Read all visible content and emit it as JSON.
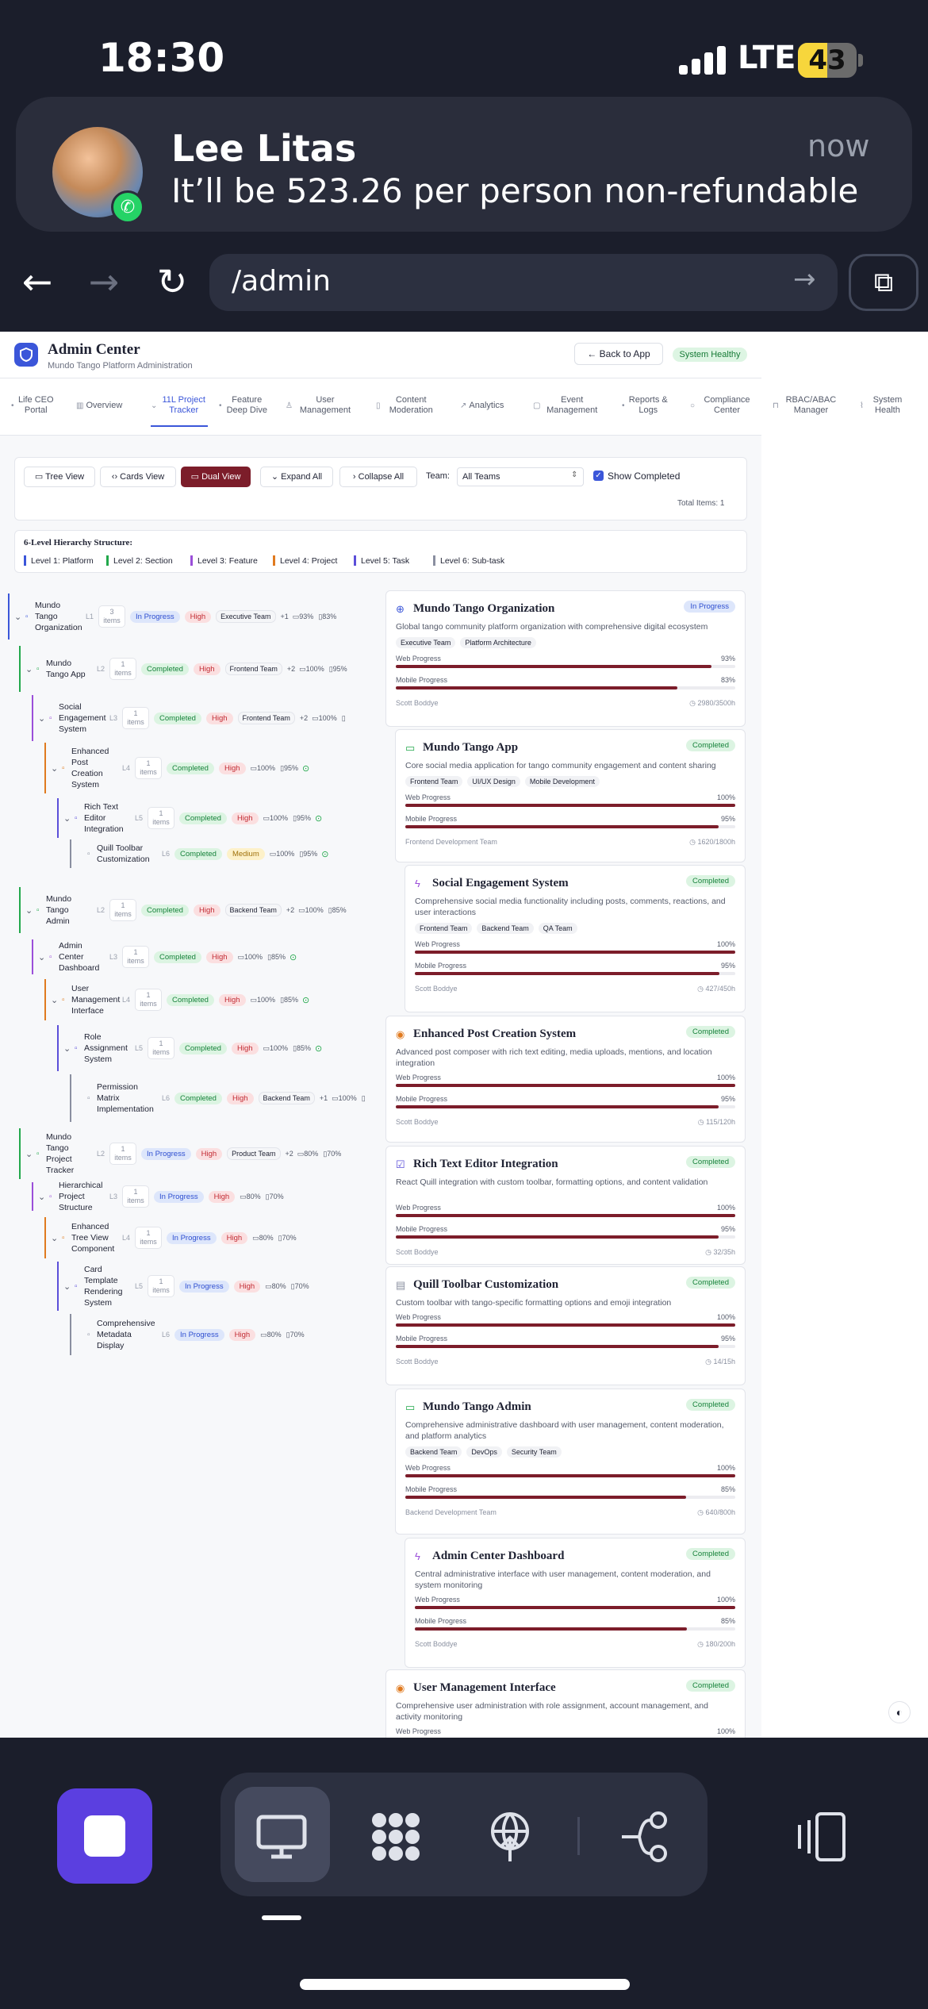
{
  "status": {
    "time": "18:30",
    "network": "LTE",
    "battery": "43"
  },
  "notification": {
    "sender": "Lee Litas",
    "time": "now",
    "message": "It’ll be 523.26 per person non-refundable"
  },
  "browser": {
    "url": "/admin"
  },
  "header": {
    "title": "Admin Center",
    "subtitle": "Mundo Tango Platform Administration",
    "back_label": "Back to App",
    "status_badge": "System Healthy"
  },
  "tabs": [
    {
      "label": "Life CEO Portal"
    },
    {
      "label": "Overview"
    },
    {
      "label": "11L Project Tracker",
      "active": true
    },
    {
      "label": "Feature Deep Dive"
    },
    {
      "label": "User Management"
    },
    {
      "label": "Content Moderation"
    },
    {
      "label": "Analytics"
    },
    {
      "label": "Event Management"
    },
    {
      "label": "Reports & Logs"
    },
    {
      "label": "Compliance Center"
    },
    {
      "label": "RBAC/ABAC Manager"
    },
    {
      "label": "System Health"
    }
  ],
  "toolbar": {
    "tree_view": "Tree View",
    "cards_view": "Cards View",
    "dual_view": "Dual View",
    "expand_all": "Expand All",
    "collapse_all": "Collapse All",
    "team_label": "Team:",
    "team_value": "All Teams",
    "show_completed": "Show Completed",
    "total_items": "Total Items: 1"
  },
  "legend": {
    "title": "6-Level Hierarchy Structure:",
    "levels": [
      "Level 1: Platform",
      "Level 2: Section",
      "Level 3: Feature",
      "Level 4: Project",
      "Level 5: Task",
      "Level 6: Sub-task"
    ],
    "colors": [
      "#3b56d9",
      "#22a84b",
      "#9b4fd9",
      "#e07a1f",
      "#5b4fd9",
      "#8a8fa0"
    ]
  },
  "tree": [
    {
      "name": "Mundo Tango Organization",
      "level": "L1",
      "items": "3 items",
      "status": "In Progress",
      "priority": "High",
      "team": "Executive Team",
      "extra": "+1",
      "web": "93%",
      "mobile": "83%"
    },
    {
      "name": "Mundo Tango App",
      "level": "L2",
      "items": "1 items",
      "status": "Completed",
      "priority": "High",
      "team": "Frontend Team",
      "extra": "+2",
      "web": "100%",
      "mobile": "95%"
    },
    {
      "name": "Social Engagement System",
      "level": "L3",
      "items": "1 items",
      "status": "Completed",
      "priority": "High",
      "team": "Frontend Team",
      "extra": "+2",
      "web": "100%",
      "mobile": ""
    },
    {
      "name": "Enhanced Post Creation System",
      "level": "L4",
      "items": "1 items",
      "status": "Completed",
      "priority": "High",
      "team": "",
      "extra": "",
      "web": "100%",
      "mobile": "95%"
    },
    {
      "name": "Rich Text Editor Integration",
      "level": "L5",
      "items": "1 items",
      "status": "Completed",
      "priority": "High",
      "team": "",
      "extra": "",
      "web": "100%",
      "mobile": "95%"
    },
    {
      "name": "Quill Toolbar Customization",
      "level": "L6",
      "items": "",
      "status": "Completed",
      "priority": "Medium",
      "team": "",
      "extra": "",
      "web": "100%",
      "mobile": "95%"
    },
    {
      "name": "Mundo Tango Admin",
      "level": "L2",
      "items": "1 items",
      "status": "Completed",
      "priority": "High",
      "team": "Backend Team",
      "extra": "+2",
      "web": "100%",
      "mobile": "85%"
    },
    {
      "name": "Admin Center Dashboard",
      "level": "L3",
      "items": "1 items",
      "status": "Completed",
      "priority": "High",
      "team": "",
      "extra": "",
      "web": "100%",
      "mobile": "85%"
    },
    {
      "name": "User Management Interface",
      "level": "L4",
      "items": "1 items",
      "status": "Completed",
      "priority": "High",
      "team": "",
      "extra": "",
      "web": "100%",
      "mobile": "85%"
    },
    {
      "name": "Role Assignment System",
      "level": "L5",
      "items": "1 items",
      "status": "Completed",
      "priority": "High",
      "team": "",
      "extra": "",
      "web": "100%",
      "mobile": "85%"
    },
    {
      "name": "Permission Matrix Implementation",
      "level": "L6",
      "items": "",
      "status": "Completed",
      "priority": "High",
      "team": "Backend Team",
      "extra": "+1",
      "web": "100%",
      "mobile": ""
    },
    {
      "name": "Mundo Tango Project Tracker",
      "level": "L2",
      "items": "1 items",
      "status": "In Progress",
      "priority": "High",
      "team": "Product Team",
      "extra": "+2",
      "web": "80%",
      "mobile": "70%"
    },
    {
      "name": "Hierarchical Project Structure",
      "level": "L3",
      "items": "1 items",
      "status": "In Progress",
      "priority": "High",
      "team": "",
      "extra": "",
      "web": "80%",
      "mobile": "70%"
    },
    {
      "name": "Enhanced Tree View Component",
      "level": "L4",
      "items": "1 items",
      "status": "In Progress",
      "priority": "High",
      "team": "",
      "extra": "",
      "web": "80%",
      "mobile": "70%"
    },
    {
      "name": "Card Template Rendering System",
      "level": "L5",
      "items": "1 items",
      "status": "In Progress",
      "priority": "High",
      "team": "",
      "extra": "",
      "web": "80%",
      "mobile": "70%"
    },
    {
      "name": "Comprehensive Metadata Display",
      "level": "L6",
      "items": "",
      "status": "In Progress",
      "priority": "High",
      "team": "",
      "extra": "",
      "web": "80%",
      "mobile": "70%"
    }
  ],
  "cards": [
    {
      "title": "Mundo Tango Organization",
      "status": "In Progress",
      "desc": "Global tango community platform organization with comprehensive digital ecosystem",
      "tags": [
        "Executive Team",
        "Platform Architecture"
      ],
      "web_label": "Web Progress",
      "web": "93%",
      "web_v": 0.93,
      "mobile_label": "Mobile Progress",
      "mobile": "83%",
      "mobile_v": 0.83,
      "owner": "Scott Boddye",
      "hours": "2980/3500h"
    },
    {
      "title": "Mundo Tango App",
      "status": "Completed",
      "desc": "Core social media application for tango community engagement and content sharing",
      "tags": [
        "Frontend Team",
        "UI/UX Design",
        "Mobile Development"
      ],
      "web_label": "Web Progress",
      "web": "100%",
      "web_v": 1.0,
      "mobile_label": "Mobile Progress",
      "mobile": "95%",
      "mobile_v": 0.95,
      "owner": "Frontend Development Team",
      "hours": "1620/1800h"
    },
    {
      "title": "Social Engagement System",
      "status": "Completed",
      "desc": "Comprehensive social media functionality including posts, comments, reactions, and user interactions",
      "tags": [
        "Frontend Team",
        "Backend Team",
        "QA Team"
      ],
      "web_label": "Web Progress",
      "web": "100%",
      "web_v": 1.0,
      "mobile_label": "Mobile Progress",
      "mobile": "95%",
      "mobile_v": 0.95,
      "owner": "Scott Boddye",
      "hours": "427/450h"
    },
    {
      "title": "Enhanced Post Creation System",
      "status": "Completed",
      "desc": "Advanced post composer with rich text editing, media uploads, mentions, and location integration",
      "tags": [],
      "web_label": "Web Progress",
      "web": "100%",
      "web_v": 1.0,
      "mobile_label": "Mobile Progress",
      "mobile": "95%",
      "mobile_v": 0.95,
      "owner": "Scott Boddye",
      "hours": "115/120h"
    },
    {
      "title": "Rich Text Editor Integration",
      "status": "Completed",
      "desc": "React Quill integration with custom toolbar, formatting options, and content validation",
      "tags": [],
      "web_label": "Web Progress",
      "web": "100%",
      "web_v": 1.0,
      "mobile_label": "Mobile Progress",
      "mobile": "95%",
      "mobile_v": 0.95,
      "owner": "Scott Boddye",
      "hours": "32/35h"
    },
    {
      "title": "Quill Toolbar Customization",
      "status": "Completed",
      "desc": "Custom toolbar with tango-specific formatting options and emoji integration",
      "tags": [],
      "web_label": "Web Progress",
      "web": "100%",
      "web_v": 1.0,
      "mobile_label": "Mobile Progress",
      "mobile": "95%",
      "mobile_v": 0.95,
      "owner": "Scott Boddye",
      "hours": "14/15h"
    },
    {
      "title": "Mundo Tango Admin",
      "status": "Completed",
      "desc": "Comprehensive administrative dashboard with user management, content moderation, and platform analytics",
      "tags": [
        "Backend Team",
        "DevOps",
        "Security Team"
      ],
      "web_label": "Web Progress",
      "web": "100%",
      "web_v": 1.0,
      "mobile_label": "Mobile Progress",
      "mobile": "85%",
      "mobile_v": 0.85,
      "owner": "Backend Development Team",
      "hours": "640/800h"
    },
    {
      "title": "Admin Center Dashboard",
      "status": "Completed",
      "desc": "Central administrative interface with user management, content moderation, and system monitoring",
      "tags": [],
      "web_label": "Web Progress",
      "web": "100%",
      "web_v": 1.0,
      "mobile_label": "Mobile Progress",
      "mobile": "85%",
      "mobile_v": 0.85,
      "owner": "Scott Boddye",
      "hours": "180/200h"
    },
    {
      "title": "User Management Interface",
      "status": "Completed",
      "desc": "Comprehensive user administration with role assignment, account management, and activity monitoring",
      "tags": [],
      "web_label": "Web Progress",
      "web": "100%",
      "web_v": 1.0,
      "mobile_label": "",
      "mobile": "",
      "mobile_v": 0,
      "owner": "",
      "hours": ""
    }
  ]
}
